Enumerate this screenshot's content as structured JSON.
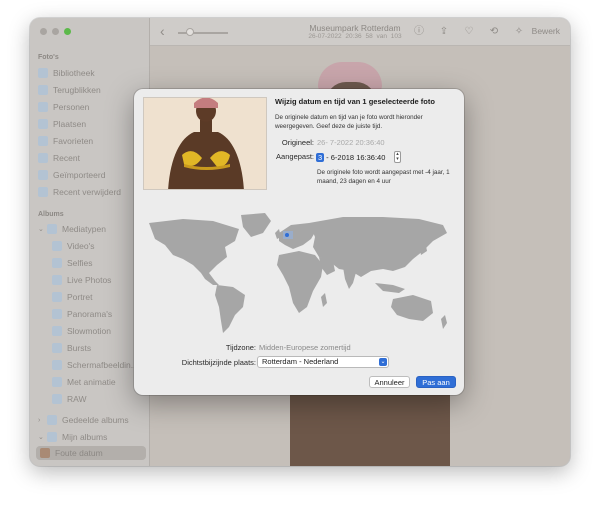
{
  "sidebar": {
    "section_photos": "Foto's",
    "section_albums": "Albums",
    "items": [
      {
        "label": "Bibliotheek"
      },
      {
        "label": "Terugblikken"
      },
      {
        "label": "Personen"
      },
      {
        "label": "Plaatsen"
      },
      {
        "label": "Favorieten"
      },
      {
        "label": "Recent"
      },
      {
        "label": "Geïmporteerd"
      },
      {
        "label": "Recent verwijderd"
      }
    ],
    "mediatypes_label": "Mediatypen",
    "mediatypes": [
      {
        "label": "Video's"
      },
      {
        "label": "Selfies"
      },
      {
        "label": "Live Photos"
      },
      {
        "label": "Portret"
      },
      {
        "label": "Panorama's"
      },
      {
        "label": "Slowmotion"
      },
      {
        "label": "Bursts"
      },
      {
        "label": "Schermafbeeldin..."
      },
      {
        "label": "Met animatie"
      },
      {
        "label": "RAW"
      }
    ],
    "shared_albums_label": "Gedeelde albums",
    "my_albums_label": "Mijn albums",
    "selected_album": "Foute datum"
  },
  "toolbar": {
    "title": "Museumpark Rotterdam",
    "date": "26-07-2022 20:36",
    "count": "58 van 103",
    "edit_label": "Bewerk"
  },
  "dialog": {
    "title": "Wijzig datum en tijd van 1 geselecteerde foto",
    "description": "De originele datum en tijd van je foto wordt hieronder weergegeven. Geef deze de juiste tijd.",
    "original_label": "Origineel:",
    "original_value": "26- 7-2022 20:36:40",
    "adjusted_label": "Aangepast:",
    "adjusted_segment": "3",
    "adjusted_value": "- 6-2018 16:36:40",
    "adjust_note": "De originele foto wordt aangepast met -4 jaar, 1 maand, 23 dagen en 4 uur",
    "timezone_label": "Tijdzone:",
    "timezone_value": "Midden-Europese zomertijd",
    "city_label": "Dichtstbijzijnde plaats:",
    "city_value": "Rotterdam - Nederland",
    "cancel_label": "Annuleer",
    "ok_label": "Pas aan"
  },
  "colors": {
    "accent": "#2f6ed6",
    "map_land": "#a6a6a6"
  }
}
